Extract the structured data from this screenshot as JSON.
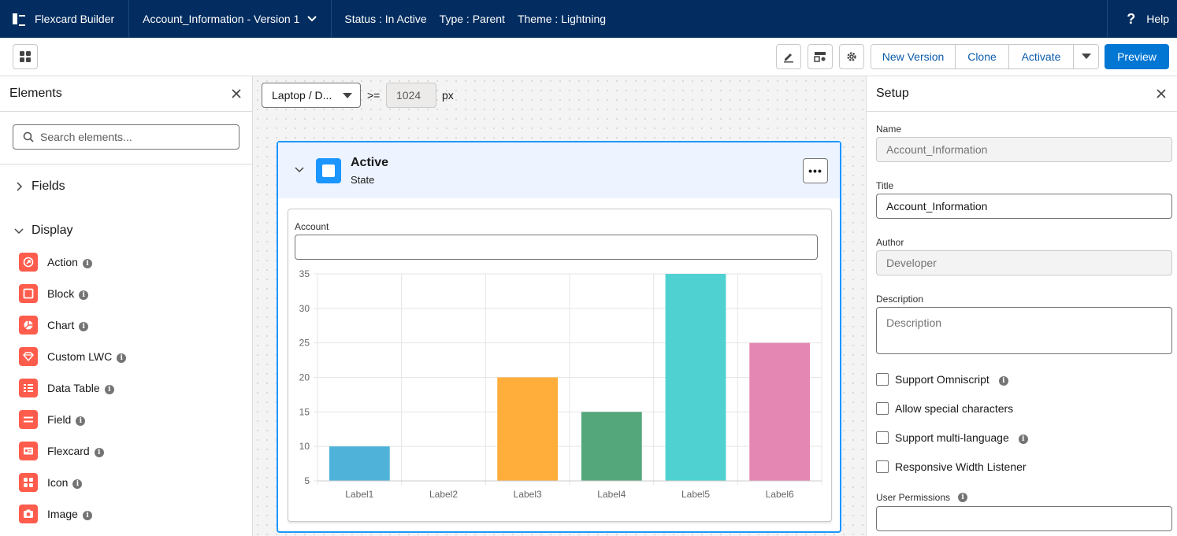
{
  "topbar": {
    "app_name": "Flexcard Builder",
    "version": "Account_Information - Version 1",
    "status": "Status : In Active",
    "type": "Type : Parent",
    "theme": "Theme : Lightning",
    "help_label": "Help"
  },
  "toolbar": {
    "new_version": "New Version",
    "clone": "Clone",
    "activate": "Activate",
    "preview": "Preview"
  },
  "elements_panel": {
    "title": "Elements",
    "search_placeholder": "Search elements...",
    "fields_label": "Fields",
    "display_label": "Display",
    "items": [
      {
        "label": "Action",
        "icon": "action-icon"
      },
      {
        "label": "Block",
        "icon": "block-icon"
      },
      {
        "label": "Chart",
        "icon": "chart-icon"
      },
      {
        "label": "Custom LWC",
        "icon": "custom-lwc-icon"
      },
      {
        "label": "Data Table",
        "icon": "data-table-icon"
      },
      {
        "label": "Field",
        "icon": "field-icon"
      },
      {
        "label": "Flexcard",
        "icon": "flexcard-icon"
      },
      {
        "label": "Icon",
        "icon": "icon-icon"
      },
      {
        "label": "Image",
        "icon": "image-icon"
      }
    ]
  },
  "canvas": {
    "device": "Laptop / D...",
    "operator": ">=",
    "width_value": "1024",
    "unit": "px",
    "state_title": "Active",
    "state_subtitle": "State",
    "more_label": "•••",
    "field_label": "Account"
  },
  "chart_data": {
    "type": "bar",
    "categories": [
      "Label1",
      "Label2",
      "Label3",
      "Label4",
      "Label5",
      "Label6"
    ],
    "values": [
      10,
      5,
      20,
      15,
      35,
      25
    ],
    "colors": [
      "#4fb3d9",
      "#a0a0a0",
      "#ffad3b",
      "#54a77b",
      "#4fd1d1",
      "#e587b3"
    ],
    "yticks": [
      5,
      10,
      15,
      20,
      25,
      30,
      35
    ],
    "ylim": [
      5,
      35
    ],
    "grid": true
  },
  "setup_panel": {
    "title": "Setup",
    "name_label": "Name",
    "name_value": "Account_Information",
    "title_label": "Title",
    "title_value": "Account_Information",
    "author_label": "Author",
    "author_value": "Developer",
    "description_label": "Description",
    "description_placeholder": "Description",
    "support_omniscript": "Support Omniscript",
    "allow_special": "Allow special characters",
    "support_multilang": "Support multi-language",
    "responsive_listener": "Responsive Width Listener",
    "user_permissions_label": "User Permissions"
  }
}
